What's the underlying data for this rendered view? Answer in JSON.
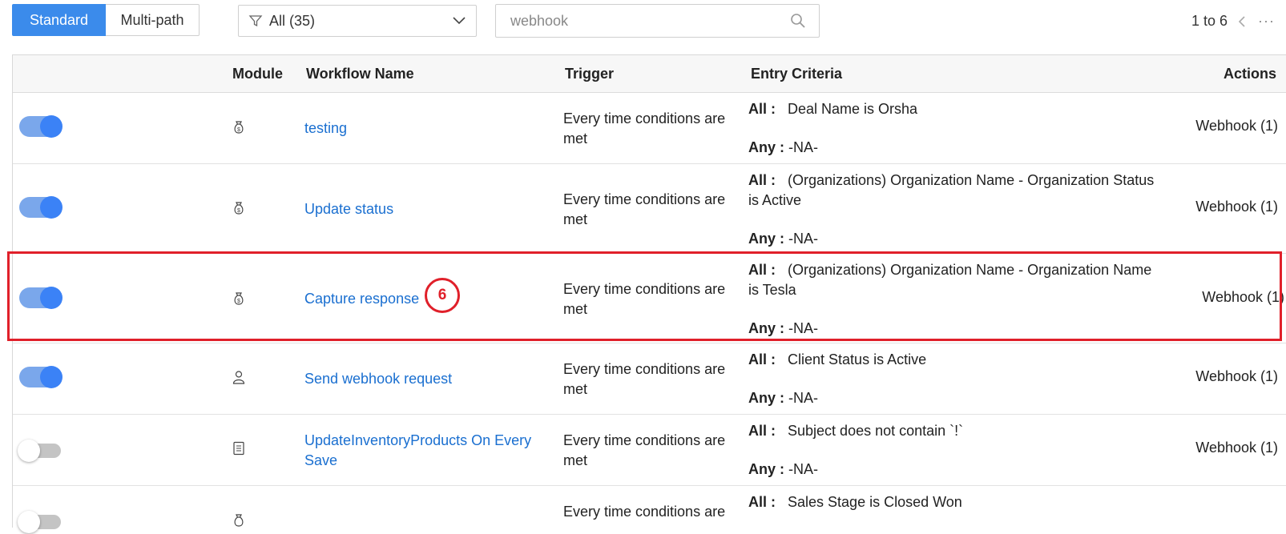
{
  "toolbar": {
    "tabs": [
      {
        "label": "Standard",
        "active": true
      },
      {
        "label": "Multi-path",
        "active": false
      }
    ],
    "filter_label": "All (35)",
    "search_value": "webhook",
    "pager_text": "1 to 6",
    "more_glyph": "···"
  },
  "table": {
    "headers": {
      "module": "Module",
      "workflow_name": "Workflow Name",
      "trigger": "Trigger",
      "entry_criteria": "Entry Criteria",
      "actions": "Actions"
    },
    "rows": [
      {
        "enabled": true,
        "module_icon": "money-bag-icon",
        "name": "testing",
        "trigger": "Every time conditions are met",
        "all_label": "All :",
        "all": "Deal Name is Orsha",
        "any_label": "Any :",
        "any": "-NA-",
        "actions": "Webhook (1)"
      },
      {
        "enabled": true,
        "module_icon": "money-bag-icon",
        "name": "Update status",
        "trigger": "Every time conditions are met",
        "all_label": "All :",
        "all": "(Organizations) Organization Name - Organization Status is Active",
        "any_label": "Any :",
        "any": "-NA-",
        "actions": "Webhook (1)"
      },
      {
        "enabled": true,
        "module_icon": "money-bag-icon",
        "name": "Capture response",
        "trigger": "Every time conditions are met",
        "all_label": "All :",
        "all": "(Organizations) Organization Name - Organization Name is Tesla",
        "any_label": "Any :",
        "any": "-NA-",
        "actions": "Webhook (1)"
      },
      {
        "enabled": true,
        "module_icon": "user-icon",
        "name": "Send webhook request",
        "trigger": "Every time conditions are met",
        "all_label": "All :",
        "all": "Client Status is Active",
        "any_label": "Any :",
        "any": "-NA-",
        "actions": "Webhook (1)"
      },
      {
        "enabled": false,
        "module_icon": "document-icon",
        "name": "UpdateInventoryProducts On Every Save",
        "trigger": "Every time conditions are met",
        "all_label": "All :",
        "all": "Subject does not contain `!`",
        "any_label": "Any :",
        "any": "-NA-",
        "actions": "Webhook (1)"
      },
      {
        "enabled": false,
        "module_icon": "money-bag-icon",
        "name": "",
        "trigger": "Every time conditions are",
        "all_label": "All :",
        "all": "Sales Stage is Closed Won",
        "any_label": "",
        "any": "",
        "actions": ""
      }
    ]
  },
  "annotation": {
    "badge": "6",
    "color": "#e0202a"
  },
  "colors": {
    "accent": "#3b8beb",
    "link": "#1a6fd0",
    "toggle_on": "#3b82f6"
  }
}
